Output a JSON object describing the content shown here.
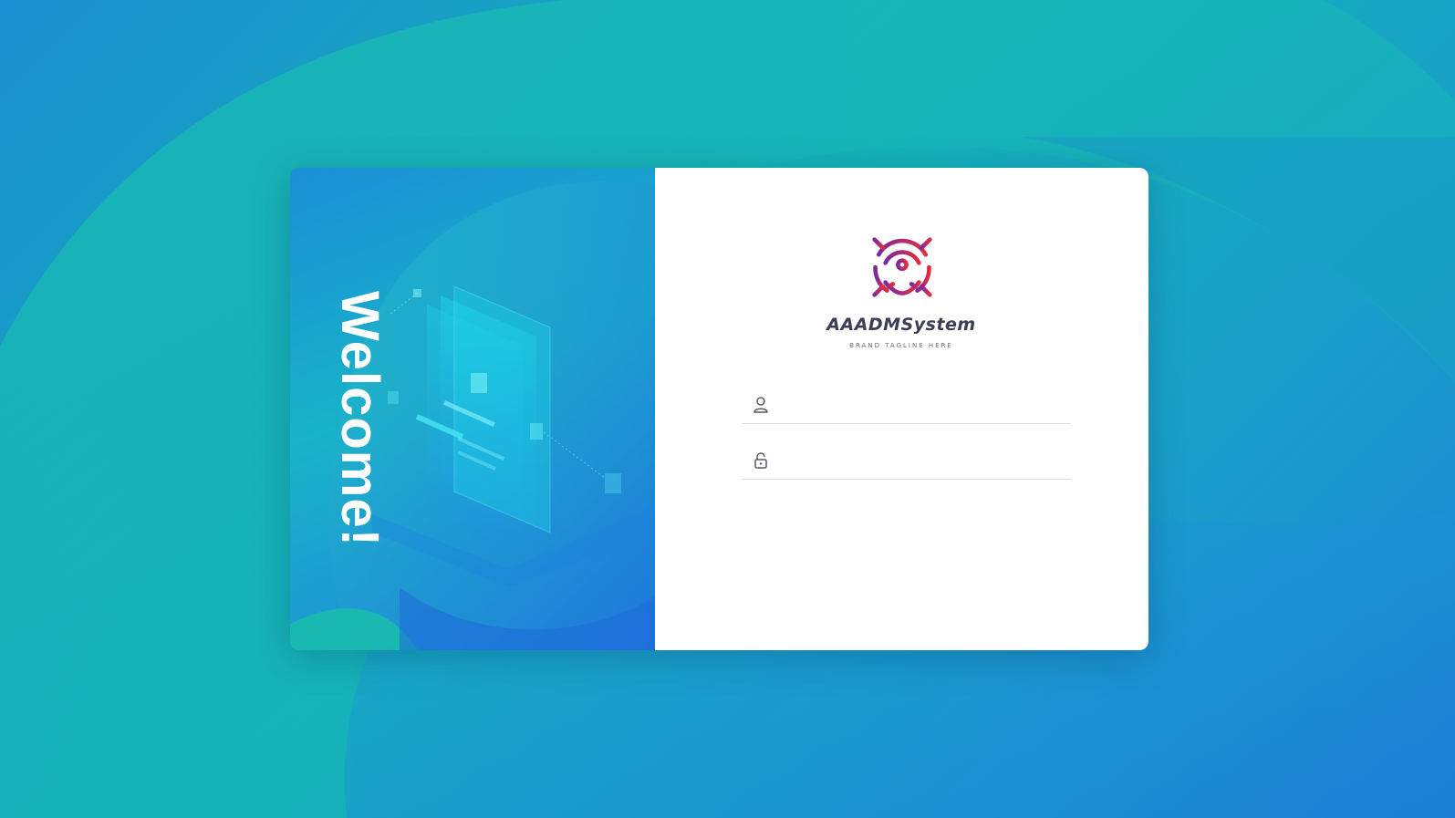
{
  "hero": {
    "welcome_text": "Welcome!"
  },
  "brand": {
    "name": "AAADMSystem",
    "tagline": "BRAND TAGLINE HERE",
    "logo_icon": "ship-wheel-anchor-icon"
  },
  "form": {
    "username": {
      "icon": "user-icon",
      "value": "",
      "placeholder": ""
    },
    "password": {
      "icon": "unlock-icon",
      "value": "",
      "placeholder": ""
    }
  },
  "colors": {
    "background_primary": "#14b3b8",
    "background_secondary": "#1a8fd0",
    "card_background": "#ffffff",
    "logo_gradient_start": "#7a2a9a",
    "logo_gradient_end": "#e52d3a",
    "brand_text": "#3a3f55"
  }
}
